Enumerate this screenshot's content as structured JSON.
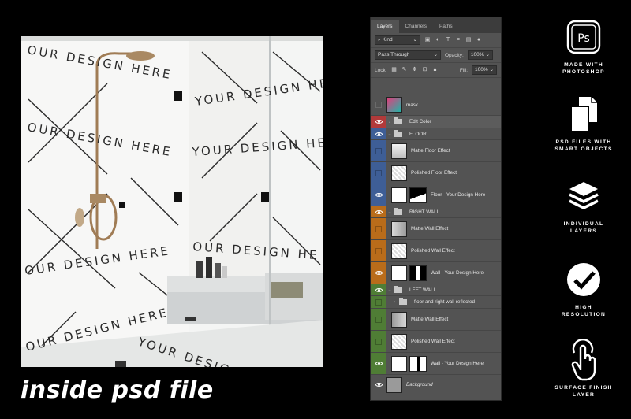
{
  "mockup": {
    "caption": "inside psd file",
    "tile_text": "OUR DESIGN HERE",
    "tile_text_short": "YOUR DESIGN HE",
    "tile_text_short2": "OUR DESIGN HE"
  },
  "panel": {
    "tabs": [
      "Layers",
      "Channels",
      "Paths"
    ],
    "filter_label": "Kind",
    "blend_mode": "Pass Through",
    "opacity_label": "Opacity:",
    "opacity_value": "100%",
    "lock_label": "Lock:",
    "fill_label": "Fill:",
    "fill_value": "100%",
    "layers": [
      {
        "name": "mask",
        "type": "layer",
        "color": "#535353",
        "visible": false
      },
      {
        "name": "Edit Color",
        "type": "group-collapsed",
        "color": "#b23a3a",
        "visible": true
      },
      {
        "name": "FLOOR",
        "type": "group-open",
        "color": "#3e5e96",
        "visible": true
      },
      {
        "name": "Matte Floor Effect",
        "type": "layer",
        "color": "#3e5e96",
        "visible": false
      },
      {
        "name": "Polished Floor Effect",
        "type": "layer",
        "color": "#3e5e96",
        "visible": false
      },
      {
        "name": "Floor - Your Design Here",
        "type": "smart-mask",
        "color": "#3e5e96",
        "visible": true
      },
      {
        "name": "RIGHT WALL",
        "type": "group-open",
        "color": "#b96c1a",
        "visible": true
      },
      {
        "name": "Matte Wall Effect",
        "type": "layer",
        "color": "#b96c1a",
        "visible": false
      },
      {
        "name": "Polished Wall Effect",
        "type": "layer",
        "color": "#b96c1a",
        "visible": false
      },
      {
        "name": "Wall - Your Design Here",
        "type": "smart-mask",
        "color": "#b96c1a",
        "visible": true
      },
      {
        "name": "LEFT WALL",
        "type": "group-open",
        "color": "#4f7d35",
        "visible": true
      },
      {
        "name": "floor and right wall reflected",
        "type": "group-collapsed",
        "color": "#4f7d35",
        "visible": false
      },
      {
        "name": "Matte Wall Effect",
        "type": "layer",
        "color": "#4f7d35",
        "visible": false
      },
      {
        "name": "Polished Wall Effect",
        "type": "layer",
        "color": "#4f7d35",
        "visible": false
      },
      {
        "name": "Wall - Your Design Here",
        "type": "smart-mask",
        "color": "#4f7d35",
        "visible": true
      },
      {
        "name": "Background",
        "type": "background",
        "color": "#535353",
        "visible": true
      }
    ]
  },
  "features": [
    {
      "label_line1": "MADE WITH",
      "label_line2": "PHOTOSHOP",
      "icon": "photoshop-icon",
      "icon_text": "Ps"
    },
    {
      "label_line1": "PSD FILES WITH",
      "label_line2": "SMART OBJECTS",
      "icon": "files-icon"
    },
    {
      "label_line1": "INDIVIDUAL",
      "label_line2": "LAYERS",
      "icon": "layers-icon"
    },
    {
      "label_line1": "HIGH",
      "label_line2": "RESOLUTION",
      "icon": "checkmark-icon"
    },
    {
      "label_line1": "SURFACE FINISH",
      "label_line2": "LAYER",
      "icon": "touch-icon"
    }
  ]
}
